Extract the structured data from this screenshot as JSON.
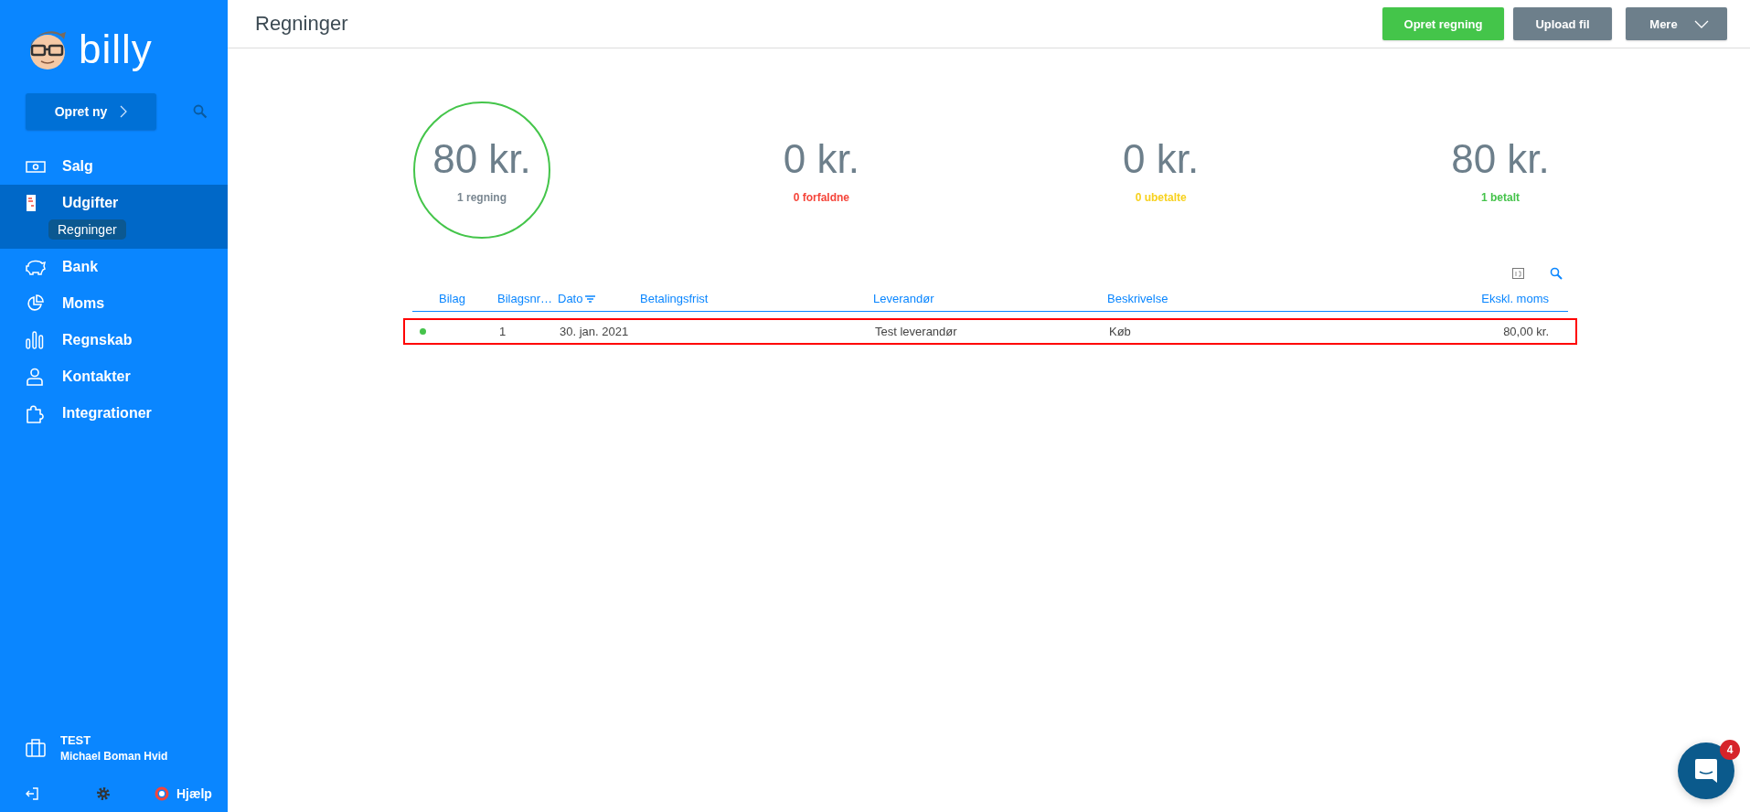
{
  "sidebar": {
    "logo": "billy",
    "create_button": "Opret ny",
    "nav": [
      {
        "label": "Salg",
        "selected": false
      },
      {
        "label": "Udgifter",
        "selected": true,
        "children": [
          {
            "label": "Regninger",
            "selected": true
          }
        ]
      },
      {
        "label": "Bank",
        "selected": false
      },
      {
        "label": "Moms",
        "selected": false
      },
      {
        "label": "Regnskab",
        "selected": false
      },
      {
        "label": "Kontakter",
        "selected": false
      },
      {
        "label": "Integrationer",
        "selected": false
      }
    ],
    "organization": {
      "name": "TEST",
      "user": "Michael Boman Hvid"
    },
    "help": "Hjælp"
  },
  "header": {
    "title": "Regninger",
    "buttons": [
      {
        "label": "Opret regning",
        "kind": "primary"
      },
      {
        "label": "Upload fil",
        "kind": "secondary"
      },
      {
        "label": "Mere",
        "kind": "dropdown"
      }
    ]
  },
  "summary": [
    {
      "amount": "80 kr.",
      "label": "1 regning",
      "color": "#7a8791",
      "selected": true
    },
    {
      "amount": "0 kr.",
      "label": "0 forfaldne",
      "color": "#f5453a",
      "selected": false
    },
    {
      "amount": "0 kr.",
      "label": "0 ubetalte",
      "color": "#f7d11e",
      "selected": false
    },
    {
      "amount": "80 kr.",
      "label": "1 betalt",
      "color": "#45c34b",
      "selected": false
    }
  ],
  "table": {
    "columns": [
      {
        "label": "Bilag",
        "sorted": false
      },
      {
        "label": "Bilagsnr…",
        "sorted": false
      },
      {
        "label": "Dato",
        "sorted": true
      },
      {
        "label": "Betalingsfrist",
        "sorted": false
      },
      {
        "label": "Leverandør",
        "sorted": false
      },
      {
        "label": "Beskrivelse",
        "sorted": false
      },
      {
        "label": "Ekskl. moms",
        "sorted": false
      }
    ],
    "rows": [
      {
        "color": "#45c34b",
        "number": "1",
        "date": "30. jan. 2021",
        "supplier": "Test leverandør",
        "description": "Køb",
        "amount": "80,00 kr.",
        "highlighted": true
      }
    ]
  },
  "chat": {
    "badge": "4"
  }
}
